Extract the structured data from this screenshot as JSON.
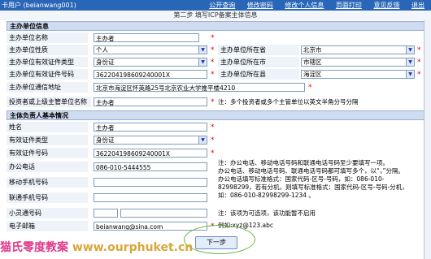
{
  "topbar": {
    "user_label": "卡用户 (beianwang001)",
    "menu": [
      "公开查询",
      "修改密码",
      "修改个人信息",
      "页面打印",
      "意见反馈",
      "退出"
    ]
  },
  "heading": "第二步 填写ICP备案主体信息",
  "section1": {
    "title": "主办单位信息",
    "fields": {
      "name_label": "主办单位名称",
      "name_value": "主办者",
      "nature_label": "主办单位性质",
      "nature_value": "个人",
      "cert_type_label": "主办单位有效证件类型",
      "cert_type_value": "身份证",
      "cert_no_label": "主办单位有效证件号码",
      "cert_no_value": "362204198609240001X",
      "address_label": "主办单位通信地址",
      "address_value": "北京市海淀区怀英路25号北京农业大学推平楼4210",
      "investor_label": "投资者或上级主管单位名称",
      "investor_value": "主办者",
      "investor_note": "注：多个投资者或多个主管单位以英文半角分号分隔",
      "province_label": "主办单位所在省",
      "province_value": "北京市",
      "city_label": "主办单位所在市",
      "city_value": "市辖区",
      "district_label": "主办单位所在县",
      "district_value": "海淀区"
    }
  },
  "section2": {
    "title": "主体负责人基本情况",
    "fields": {
      "name_label": "姓名",
      "name_value": "主办者",
      "cert_type_label": "有效证件类型",
      "cert_type_value": "身份证",
      "cert_no_label": "有效证件号码",
      "cert_no_value": "362204198609240001X",
      "office_label": "办公电话",
      "office_value": "086-010-5444555",
      "mobile_label": "移动手机号码",
      "mobile_value": "",
      "unicom_label": "联通手机号码",
      "unicom_value": "",
      "phs_label": "小灵通号码",
      "phs_value": "",
      "email_label": "电子邮箱",
      "email_value": "beianwang@sina.com",
      "note1": "注：办公电话、移动电话号码和联通电话号码至少要填写一项。",
      "note2": "办公电话、移动电话号码、联通电话号码都可填写多个，以“，”分隔。",
      "note3": "办公电话填写标准格式：国家代码-区号-号码，如：086-010-82998299，若有分机，则填写标准格式：国家代码-区号-号码-分机，如：086-010-82998299-1234 。",
      "note4": "注：该项为可选项，该功能暂不启用",
      "email_example": "例如:xyz@123.abc"
    }
  },
  "next_button": "下一步",
  "watermark": {
    "text": "猫氏零度教案 ",
    "url": "www.ourphuket.cn"
  }
}
